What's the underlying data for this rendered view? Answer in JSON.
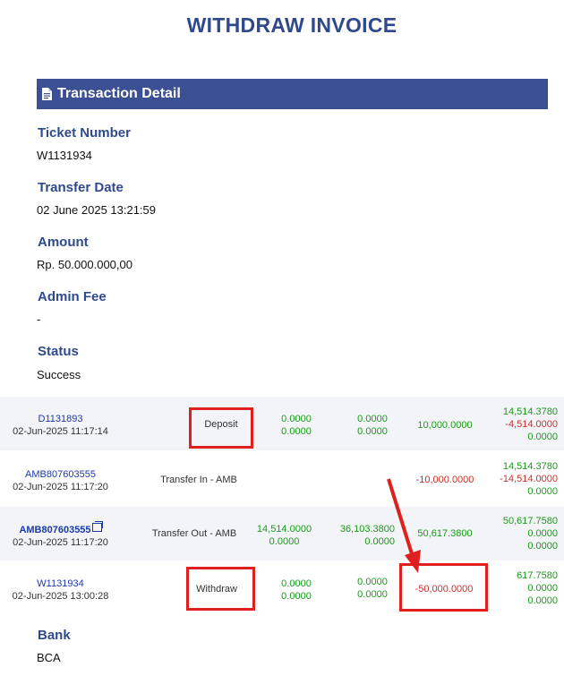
{
  "page": {
    "title": "WITHDRAW INVOICE"
  },
  "section": {
    "title": "Transaction Detail",
    "icon": "document-icon"
  },
  "fields": [
    {
      "label": "Ticket Number",
      "value": "W1131934"
    },
    {
      "label": "Transfer Date",
      "value": "02 June 2025 13:21:59"
    },
    {
      "label": "Amount",
      "value": "Rp. 50.000.000,00"
    },
    {
      "label": "Admin Fee",
      "value": "-"
    },
    {
      "label": "Status",
      "value": "Success"
    }
  ],
  "transactions": [
    {
      "id": "D1131893",
      "date": "02-Jun-2025 11:17:14",
      "type": "Deposit",
      "col1": [
        "0.0000",
        "0.0000"
      ],
      "col2": [
        "0.0000",
        "0.0000"
      ],
      "amount": "10,000.0000",
      "balances": [
        "14,514.3780",
        "-4,514.0000",
        "0.0000"
      ]
    },
    {
      "id": "AMB807603555",
      "date": "02-Jun-2025 11:17:20",
      "type": "Transfer In - AMB",
      "col1": [
        "",
        ""
      ],
      "col2": [
        "",
        ""
      ],
      "amount": "-10,000.0000",
      "balances": [
        "14,514.3780",
        "-14,514.0000",
        "0.0000"
      ]
    },
    {
      "id": "AMB807603555",
      "date": "02-Jun-2025 11:17:20",
      "type": "Transfer Out - AMB",
      "col1": [
        "14,514.0000",
        "0.0000"
      ],
      "col2": [
        "36,103.3800",
        "0.0000"
      ],
      "amount": "50,617.3800",
      "balances": [
        "50,617.7580",
        "0.0000",
        "0.0000"
      ]
    },
    {
      "id": "W1131934",
      "date": "02-Jun-2025 13:00:28",
      "type": "Withdraw",
      "col1": [
        "0.0000",
        "0.0000"
      ],
      "col2": [
        "0.0000",
        "0.0000"
      ],
      "amount": "-50,000.0000",
      "balances": [
        "617.7580",
        "0.0000",
        "0.0000"
      ]
    }
  ],
  "bank": {
    "label": "Bank",
    "value": "BCA"
  },
  "colors": {
    "brand": "#3b5093",
    "title": "#2f4a8c",
    "positive": "#1a9a1a",
    "negative": "#c8322e",
    "highlight": "#e0201e"
  }
}
